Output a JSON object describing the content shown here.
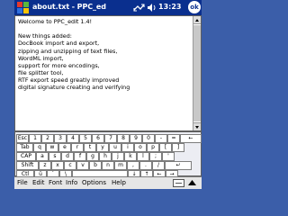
{
  "window": {
    "title": "about.txt - PPC_ed",
    "time": "13:23",
    "ok_label": "ok"
  },
  "document": {
    "lines": [
      "Welcome to PPC_edit 1.4!",
      "",
      "New things added:",
      "DocBook import and export,",
      "zipping and unzipping of text files,",
      "WordML import,",
      "support for more encodings,",
      "file splitter tool,",
      "RTF export speed greatly improved",
      "digital signature creating and verifying",
      "",
      "",
      "",
      "",
      ""
    ]
  },
  "keyboard": {
    "row1": [
      "Esc",
      "1",
      "2",
      "3",
      "4",
      "5",
      "6",
      "7",
      "8",
      "9",
      "0",
      "-",
      "=",
      "←"
    ],
    "row2": [
      "Tab",
      "q",
      "w",
      "e",
      "r",
      "t",
      "y",
      "u",
      "i",
      "o",
      "p",
      "[",
      "]"
    ],
    "row3": [
      "CAP",
      "a",
      "s",
      "d",
      "f",
      "g",
      "h",
      "j",
      "k",
      "l",
      ";",
      "'"
    ],
    "row4": [
      "Shift",
      "z",
      "x",
      "c",
      "v",
      "b",
      "n",
      "m",
      ",",
      ".",
      "/",
      "↵"
    ],
    "row5": [
      "Ctl",
      "ü",
      "`",
      "\\",
      "",
      "↓",
      "↑",
      "←",
      "→"
    ]
  },
  "menu": {
    "items": [
      "File",
      "Edit",
      "Font",
      "Info",
      "Options",
      "Help"
    ]
  },
  "icons": {
    "start": "windows-flag-icon",
    "network": "network-icon",
    "volume": "speaker-icon"
  },
  "colors": {
    "titlebar": "#0a2f8e",
    "background": "#3b5ea9"
  }
}
